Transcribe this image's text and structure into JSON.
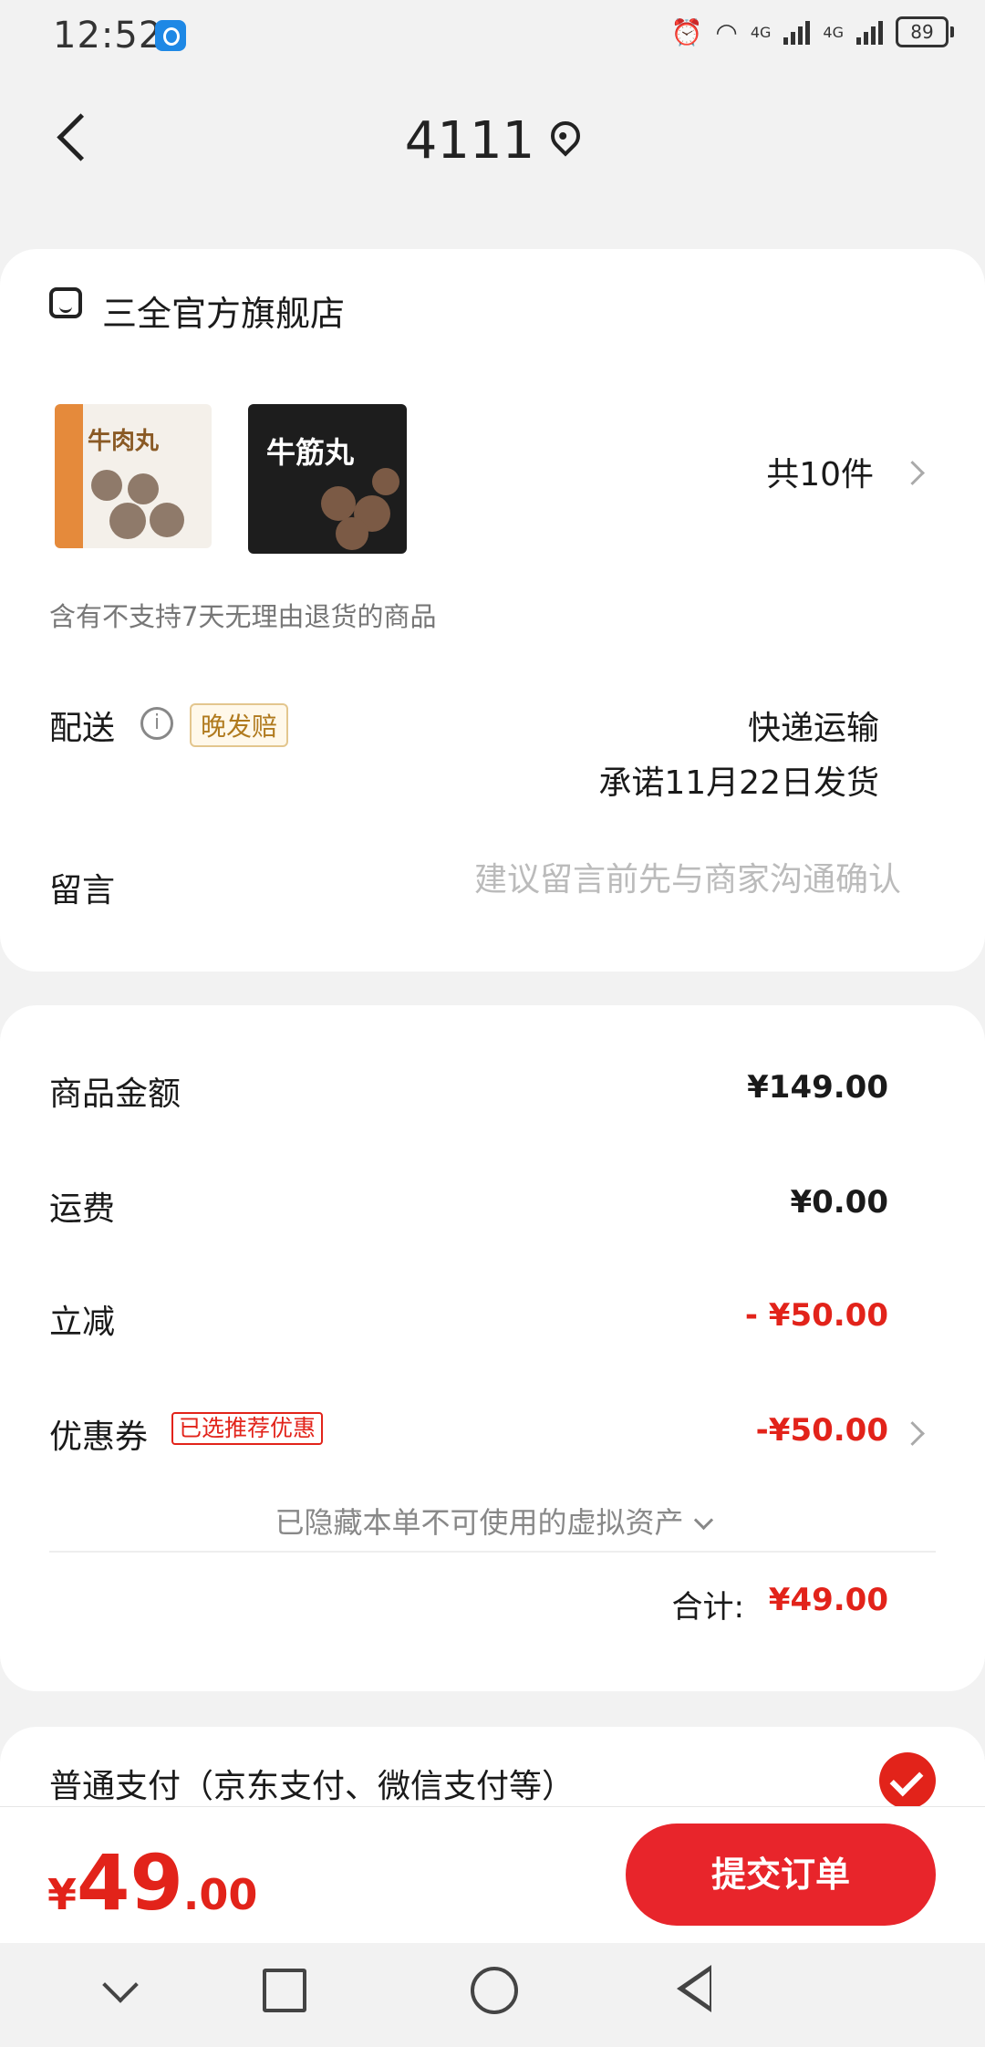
{
  "status_bar": {
    "time": "12:52",
    "signal1": "4G",
    "signal2": "4G",
    "battery": "89"
  },
  "header": {
    "title": "4111"
  },
  "store": {
    "name": "三全官方旗舰店",
    "products": [
      {
        "image_text": "牛肉丸"
      },
      {
        "image_text": "牛筋丸"
      }
    ],
    "count_text": "共10件",
    "return_note": "含有不支持7天无理由退货的商品",
    "delivery_label": "配送",
    "late_tag": "晚发赔",
    "ship_method": "快递运输",
    "ship_date": "承诺11月22日发货",
    "message_label": "留言",
    "message_placeholder": "建议留言前先与商家沟通确认"
  },
  "price": {
    "goods_label": "商品金额",
    "goods_value": "¥149.00",
    "shipping_label": "运费",
    "shipping_value": "¥0.00",
    "discount_label": "立减",
    "discount_value": "- ¥50.00",
    "coupon_label": "优惠券",
    "coupon_tag": "已选推荐优惠",
    "coupon_value": "-¥50.00",
    "hidden_assets": "已隐藏本单不可使用的虚拟资产",
    "total_label": "合计:",
    "total_value": "¥49.00"
  },
  "payment": {
    "label": "普通支付（京东支付、微信支付等）",
    "selected": true
  },
  "bottom_bar": {
    "currency": "¥",
    "amount_int": "49",
    "amount_dec": ".00",
    "submit_label": "提交订单"
  },
  "colors": {
    "accent": "#e2231a",
    "background": "#f2f2f2"
  }
}
